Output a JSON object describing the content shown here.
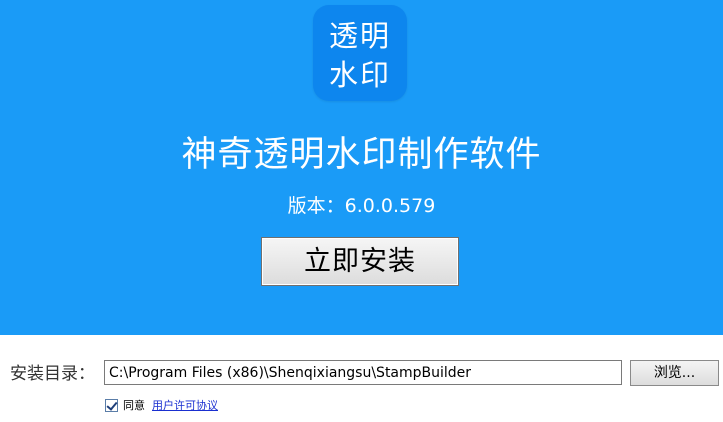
{
  "hero": {
    "background_color": "#1a9bf7",
    "icon": {
      "name": "app-logo-icon",
      "line1": "透明",
      "line2": "水印",
      "background_color": "#0d86ee"
    },
    "title": "神奇透明水印制作软件",
    "version": "版本：6.0.0.579",
    "install_button_label": "立即安装"
  },
  "install_dir": {
    "label": "安装目录：",
    "value": "C:\\Program Files (x86)\\Shenqixiangsu\\StampBuilder",
    "browse_label": "浏览..."
  },
  "agreement": {
    "checked": true,
    "label": "同意",
    "link_text": "用户许可协议",
    "link_color": "#1a2fd0"
  }
}
